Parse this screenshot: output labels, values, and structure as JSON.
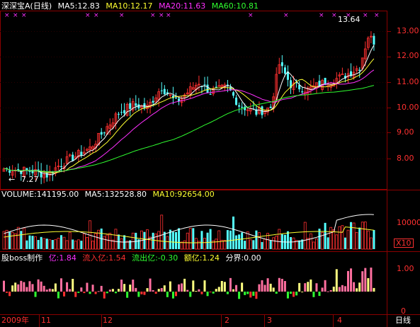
{
  "header": {
    "stock_name": "深深宝A",
    "period": "(日线)",
    "ma5": "MA5:12.83",
    "ma10": "MA10:12.17",
    "ma20": "MA20:11.63",
    "ma60": "MA60:10.81"
  },
  "price_axis": [
    "13.00",
    "12.00",
    "11.00",
    "10.00",
    "9.00",
    "8.00"
  ],
  "annotations": {
    "high": "13.64",
    "low": "7.27",
    "low_arrow": "←"
  },
  "volume_header": {
    "volume": "VOLUME:141195.00",
    "ma5": "MA5:132528.80",
    "ma10": "MA10:92654.00"
  },
  "volume_axis": {
    "label": "10000",
    "multiplier": "X10"
  },
  "indicator_header": {
    "name": "股boss制作",
    "yi": "亿:1.84",
    "inflow": "流入亿:1.54",
    "outflow": "流出亿:-0.30",
    "net": "额亿:1.24",
    "boundary": "分界:0.00"
  },
  "indicator_axis": {
    "top": "1.00",
    "zero": "0"
  },
  "x_axis": [
    "2009年",
    "11",
    "12",
    "2",
    "3",
    "4"
  ],
  "bottom_right": "日线",
  "colors": {
    "up": "#ff3030",
    "down": "#54ffff",
    "ma5": "#ffffff",
    "ma10": "#ffff30",
    "ma20": "#ff30ff",
    "ma60": "#30ff30",
    "grid": "#8b0000"
  },
  "chart_data": {
    "type": "candlestick",
    "price_ylim": [
      7.0,
      13.8
    ],
    "days": 130,
    "series_note": ""
  }
}
